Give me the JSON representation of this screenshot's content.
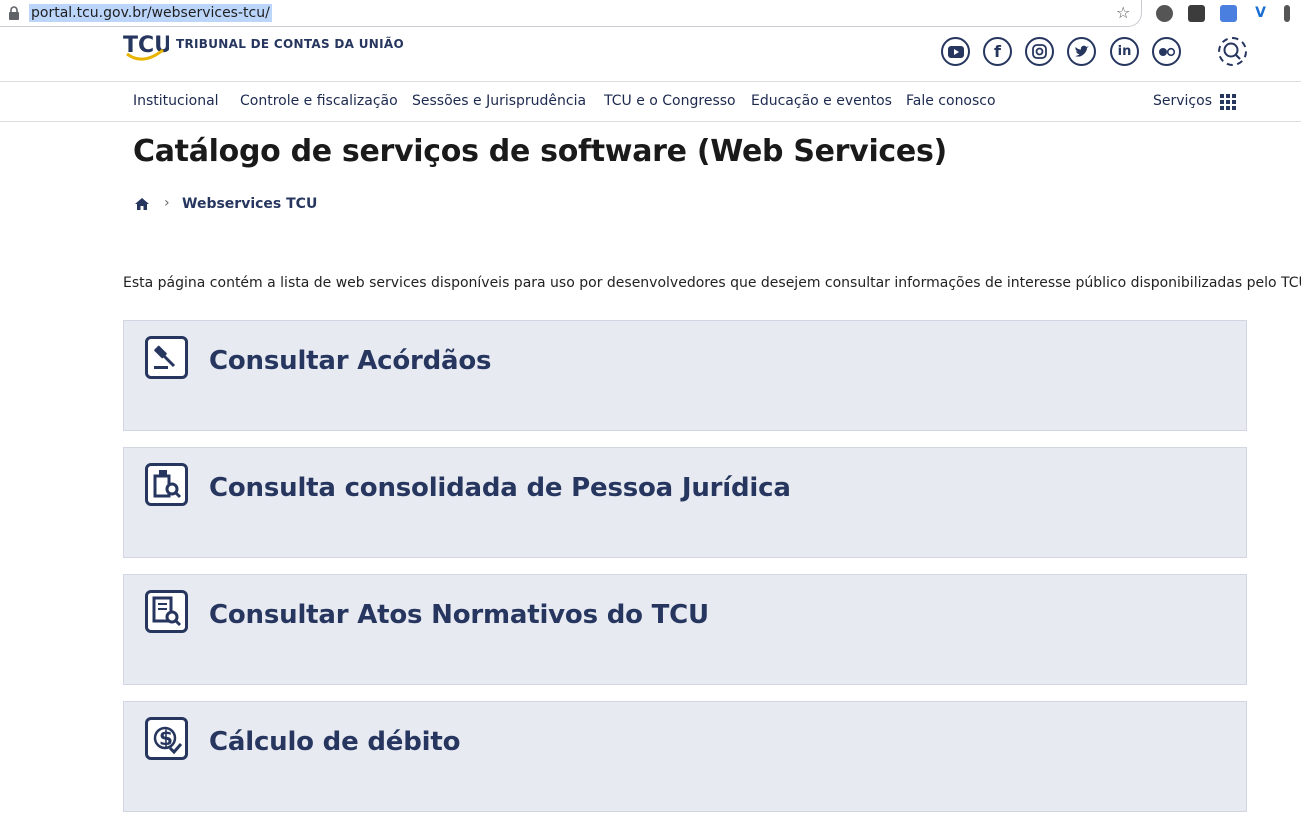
{
  "browser": {
    "url": "portal.tcu.gov.br/webservices-tcu/"
  },
  "header": {
    "logo_abbr": "TCU",
    "logo_text": "TRIBUNAL DE CONTAS DA UNIÃO",
    "social": [
      {
        "icon": "youtube-icon",
        "glyph": "▶"
      },
      {
        "icon": "facebook-icon",
        "glyph": "f"
      },
      {
        "icon": "instagram-icon",
        "glyph": "◎"
      },
      {
        "icon": "twitter-icon",
        "glyph": "🐦"
      },
      {
        "icon": "linkedin-icon",
        "glyph": "in"
      },
      {
        "icon": "flickr-icon",
        "glyph": "●○"
      }
    ]
  },
  "nav": {
    "items": [
      "Institucional",
      "Controle e fiscalização",
      "Sessões e Jurisprudência",
      "TCU e o Congresso",
      "Educação e eventos",
      "Fale conosco"
    ],
    "services_label": "Serviços"
  },
  "page": {
    "title": "Catálogo de serviços de software (Web Services)",
    "breadcrumb_current": "Webservices TCU",
    "intro": "Esta página contém a lista de web services disponíveis para uso por desenvolvedores que desejem consultar informações de interesse público disponibilizadas pelo TCU."
  },
  "cards": [
    {
      "title": "Consultar Acórdãos",
      "icon": "gavel-icon"
    },
    {
      "title": "Consulta consolidada de Pessoa Jurídica",
      "icon": "company-search-icon"
    },
    {
      "title": "Consultar Atos Normativos do TCU",
      "icon": "document-search-icon"
    },
    {
      "title": "Cálculo de débito",
      "icon": "money-check-icon"
    }
  ],
  "colors": {
    "brand": "#26365f",
    "card_bg": "#e8eaf2",
    "logo_yellow": "#e8b400"
  }
}
